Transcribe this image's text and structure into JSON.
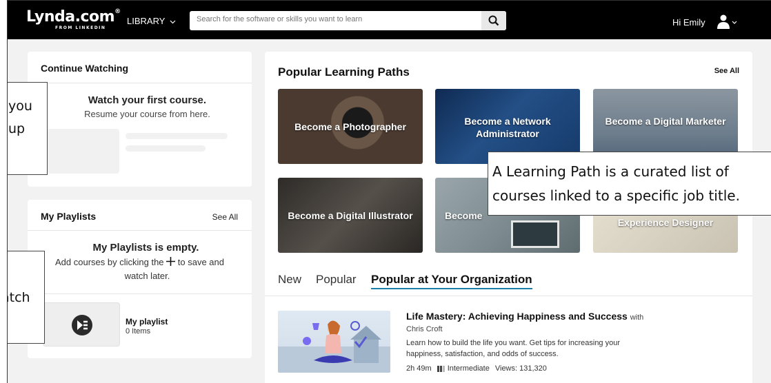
{
  "header": {
    "logo_text": "Lynda.com",
    "logo_mark": "®",
    "logo_sub": "FROM LINKEDIN",
    "library_label": "LIBRARY",
    "search_placeholder": "Search for the software or skills you want to learn",
    "greeting": "Hi Emily"
  },
  "continue_watching": {
    "title": "Continue Watching",
    "headline": "Watch your first course.",
    "subline": "Resume your course from here."
  },
  "playlists": {
    "title": "My Playlists",
    "see_all": "See All",
    "empty_title": "My Playlists is empty.",
    "empty_line1_a": "Add courses by clicking the",
    "empty_line1_b": "to save and",
    "empty_line2": "watch later.",
    "playlist_name": "My playlist",
    "playlist_count": "0 Items"
  },
  "learning_paths": {
    "title": "Popular Learning Paths",
    "see_all": "See All",
    "items": [
      {
        "label": "Become a Photographer"
      },
      {
        "label": "Become a Network Administrator"
      },
      {
        "label": "Become a Digital Marketer"
      },
      {
        "label": "Become a Digital Illustrator"
      },
      {
        "label": "Become"
      },
      {
        "label": "Experience Designer"
      }
    ],
    "colors": [
      "#5a4a3e",
      "#1c3f6e",
      "#6d7d8c",
      "#3e3a36",
      "#7c8a8f",
      "#d9d3c4"
    ]
  },
  "tabs": {
    "new": "New",
    "popular": "Popular",
    "org": "Popular at Your Organization",
    "accent": "#1a7fa8"
  },
  "course": {
    "title": "Life Mastery: Achieving Happiness and Success",
    "with": "with",
    "author": "Chris Croft",
    "desc1": "Learn how to build the life you want. Get tips for increasing your",
    "desc2": "happiness, satisfaction, and odds of success.",
    "duration": "2h 49m",
    "level": "Intermediate",
    "views": "Views: 131,320"
  },
  "callouts": {
    "left_top_1": "you",
    "left_top_2": "up",
    "left_bottom": "atch",
    "right_1": "A Learning Path is a curated list of",
    "right_2": "courses linked to a specific job title."
  }
}
